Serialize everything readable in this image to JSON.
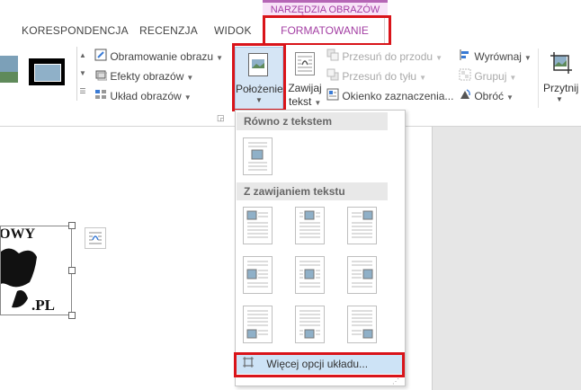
{
  "context_tab_group": "NARZĘDZIA OBRAZÓW",
  "tabs": {
    "korespondencja": "KORESPONDENCJA",
    "recenzja": "RECENZJA",
    "widok": "WIDOK",
    "formatowanie": "FORMATOWANIE"
  },
  "ribbon": {
    "obramowanie": "Obramowanie obrazu",
    "efekty": "Efekty obrazów",
    "uklad": "Układ obrazów",
    "polozenie_line1": "Położenie",
    "zawijaj_line1": "Zawijaj",
    "zawijaj_line2": "tekst",
    "przesun_przod": "Przesuń do przodu",
    "przesun_tyl": "Przesuń do tyłu",
    "okienko": "Okienko zaznaczenia...",
    "wyrownaj": "Wyrównaj",
    "grupuj": "Grupuj",
    "obroc": "Obróć",
    "przytnij": "Przytnij"
  },
  "dropdown": {
    "section1": "Równo z tekstem",
    "section2": "Z zawijaniem tekstu",
    "more_options": "Więcej opcji układu..."
  },
  "document": {
    "image_text_top": "OWY",
    "image_text_bottom": ".PL"
  },
  "colors": {
    "accent": "#a33ea3",
    "highlight": "#d9141a",
    "hover": "#cde3f6"
  }
}
